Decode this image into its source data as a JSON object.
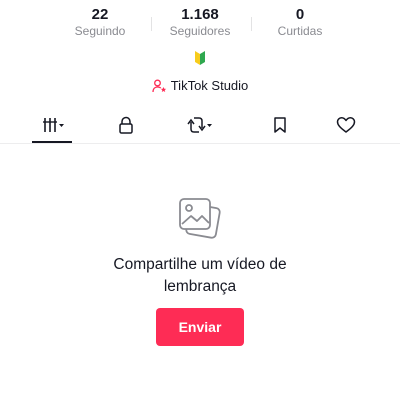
{
  "stats": [
    {
      "value": "22",
      "label": "Seguindo"
    },
    {
      "value": "1.168",
      "label": "Seguidores"
    },
    {
      "value": "0",
      "label": "Curtidas"
    }
  ],
  "badge_icon": "beginner-leaf-icon",
  "studio": {
    "label": "TikTok Studio",
    "icon": "person-star-icon"
  },
  "tabs": [
    {
      "icon": "videos-grid-icon",
      "active": true
    },
    {
      "icon": "lock-icon",
      "active": false
    },
    {
      "icon": "repost-icon",
      "active": false
    },
    {
      "icon": "bookmark-icon",
      "active": false
    },
    {
      "icon": "heart-icon",
      "active": false
    }
  ],
  "empty_state": {
    "icon": "photos-icon",
    "line1": "Compartilhe um vídeo de",
    "line2": "lembrança",
    "button_label": "Enviar"
  },
  "colors": {
    "accent": "#fe2c55",
    "text": "#161823",
    "muted": "#8a8b91"
  }
}
